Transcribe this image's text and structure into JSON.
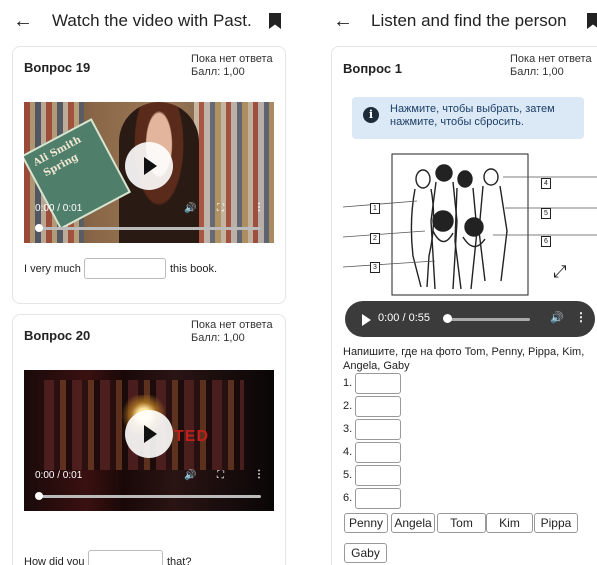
{
  "left": {
    "title": "Watch the video with Past...",
    "q19": {
      "title": "Вопрос 19",
      "status1": "Пока нет ответа",
      "status2": "Балл: 1,00",
      "book_line1": "Ali Smith",
      "book_line2": "Spring",
      "time": "0:00 / 0:01",
      "progress": 0,
      "sentence_before": "I very much",
      "sentence_after": "this book."
    },
    "q20": {
      "title": "Вопрос 20",
      "status1": "Пока нет ответа",
      "status2": "Балл: 1,00",
      "stage_text": "TED",
      "time": "0:00 / 0:01",
      "progress": 0,
      "sentence_before": "How did you",
      "sentence_after": "that?"
    }
  },
  "right": {
    "title": "Listen and find the person",
    "q1": {
      "title": "Вопрос 1",
      "status1": "Пока нет ответа",
      "status2": "Балл: 1,00",
      "info_line1": "Нажмите, чтобы выбрать, затем",
      "info_line2": "нажмите, чтобы сбросить.",
      "figure_labels": [
        "1",
        "2",
        "3",
        "4",
        "5",
        "6"
      ],
      "audio_time": "0:00 / 0:55",
      "audio_progress": 0,
      "instruction_line1": "Напишите, где на фото Tom, Penny, Pippa, Kim,",
      "instruction_line2": "Angela, Gaby",
      "answer_labels": [
        "1.",
        "2.",
        "3.",
        "4.",
        "5.",
        "6."
      ],
      "chips": [
        "Penny",
        "Angela",
        "Tom",
        "Kim",
        "Pippa",
        "Gaby"
      ]
    }
  },
  "icons": {
    "back": "arrow-left-icon",
    "bookmark": "bookmark-icon",
    "info": "info-icon",
    "expand": "expand-icon",
    "volume": "volume-icon",
    "fullscreen": "fullscreen-icon",
    "more": "more-vert-icon"
  }
}
